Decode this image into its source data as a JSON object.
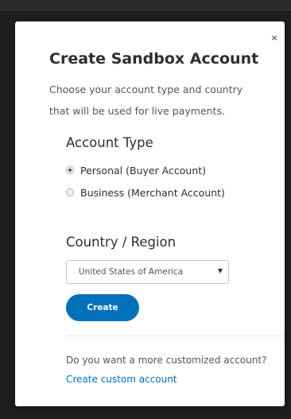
{
  "modal": {
    "close_label": "×",
    "title": "Create Sandbox Account",
    "subtitle_line1": "Choose your account type and country",
    "subtitle_line2": "that will be used for live payments."
  },
  "account_type": {
    "heading": "Account Type",
    "options": [
      {
        "label": "Personal (Buyer Account)",
        "selected": true
      },
      {
        "label": "Business (Merchant Account)",
        "selected": false
      }
    ]
  },
  "country": {
    "heading": "Country / Region",
    "selected": "United States of America",
    "arrow": "▼"
  },
  "actions": {
    "create_label": "Create"
  },
  "footer": {
    "question": "Do you want a more customized account?",
    "link_label": "Create custom account"
  },
  "colors": {
    "accent": "#0070ba",
    "backdrop": "#1f1f1f"
  }
}
